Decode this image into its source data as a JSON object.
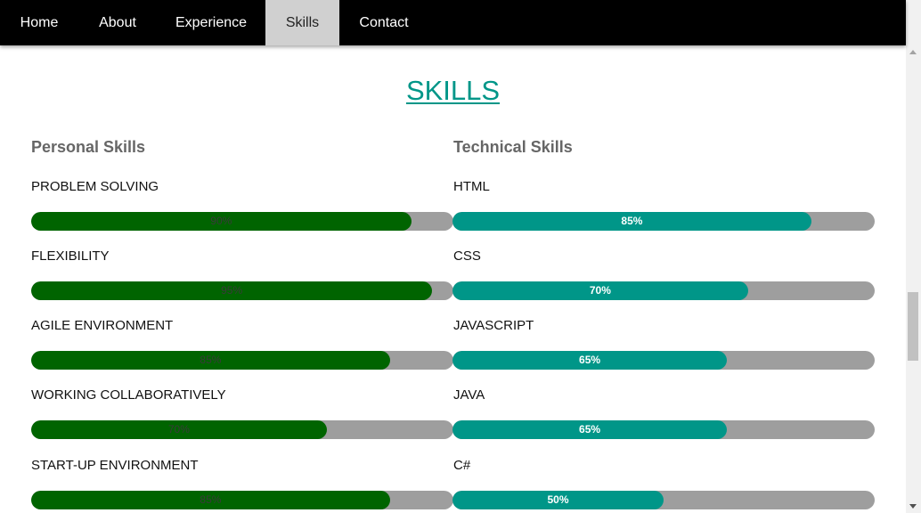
{
  "nav": {
    "items": [
      {
        "label": "Home",
        "active": false
      },
      {
        "label": "About",
        "active": false
      },
      {
        "label": "Experience",
        "active": false
      },
      {
        "label": "Skills",
        "active": true
      },
      {
        "label": "Contact",
        "active": false
      }
    ]
  },
  "section": {
    "title": "SKILLS"
  },
  "personal": {
    "title": "Personal Skills",
    "items": [
      {
        "label": "PROBLEM SOLVING",
        "percent": 90,
        "text": "90%"
      },
      {
        "label": "FLEXIBILITY",
        "percent": 95,
        "text": "95%"
      },
      {
        "label": "AGILE ENVIRONMENT",
        "percent": 85,
        "text": "85%"
      },
      {
        "label": "WORKING COLLABORATIVELY",
        "percent": 70,
        "text": "70%"
      },
      {
        "label": "START-UP ENVIRONMENT",
        "percent": 85,
        "text": "85%"
      }
    ]
  },
  "technical": {
    "title": "Technical Skills",
    "items": [
      {
        "label": "HTML",
        "percent": 85,
        "text": "85%"
      },
      {
        "label": "CSS",
        "percent": 70,
        "text": "70%"
      },
      {
        "label": "JAVASCRIPT",
        "percent": 65,
        "text": "65%"
      },
      {
        "label": "JAVA",
        "percent": 65,
        "text": "65%"
      },
      {
        "label": "C#",
        "percent": 50,
        "text": "50%"
      }
    ]
  },
  "colors": {
    "nav_bg": "#000000",
    "nav_active_bg": "#d0d0d0",
    "accent": "#009688",
    "personal_bar": "#006400",
    "bar_track": "#9e9e9e"
  }
}
